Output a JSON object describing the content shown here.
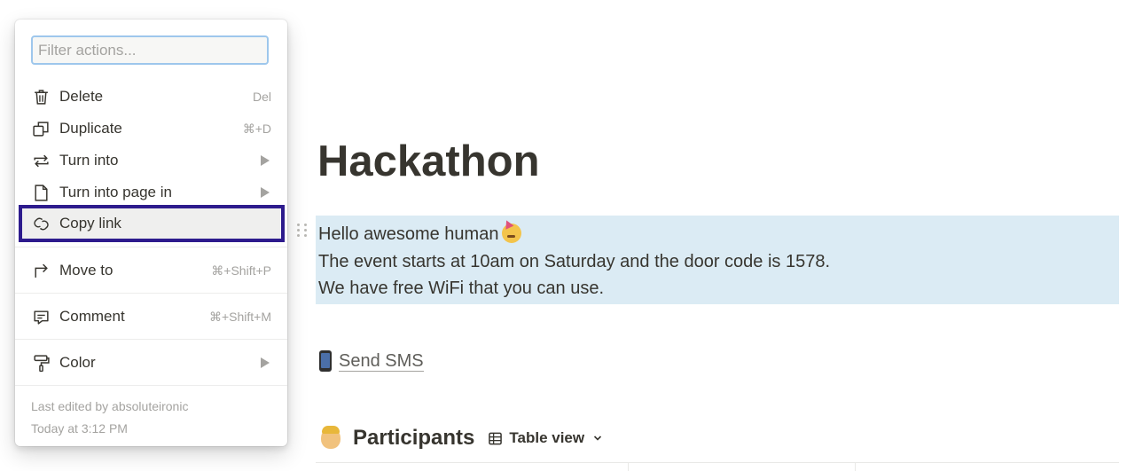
{
  "page": {
    "title": "Hackathon",
    "callout_lines": [
      "Hello awesome human",
      "The event starts at 10am on Saturday and the door code is 1578.",
      "We have free WiFi that you can use."
    ],
    "callout_bg": "#dbebf4",
    "sms_link": "Send SMS",
    "database": {
      "title": "Participants",
      "view_label": "Table view"
    }
  },
  "menu": {
    "filter_placeholder": "Filter actions...",
    "items": [
      {
        "label": "Delete",
        "shortcut": "Del",
        "icon": "trash-icon"
      },
      {
        "label": "Duplicate",
        "shortcut": "⌘+D",
        "icon": "duplicate-icon"
      },
      {
        "label": "Turn into",
        "submenu": true,
        "icon": "turn-into-icon"
      },
      {
        "label": "Turn into page in",
        "submenu": true,
        "icon": "page-icon"
      },
      {
        "label": "Copy link",
        "icon": "link-icon",
        "highlighted": true
      },
      {
        "label": "Move to",
        "shortcut": "⌘+Shift+P",
        "icon": "move-to-icon"
      },
      {
        "label": "Comment",
        "shortcut": "⌘+Shift+M",
        "icon": "comment-icon"
      },
      {
        "label": "Color",
        "submenu": true,
        "icon": "paint-roller-icon"
      }
    ],
    "footer": {
      "edited_by": "Last edited by absoluteironic",
      "edited_at": "Today at 3:12 PM"
    },
    "highlight_color": "#2d1b8d"
  }
}
